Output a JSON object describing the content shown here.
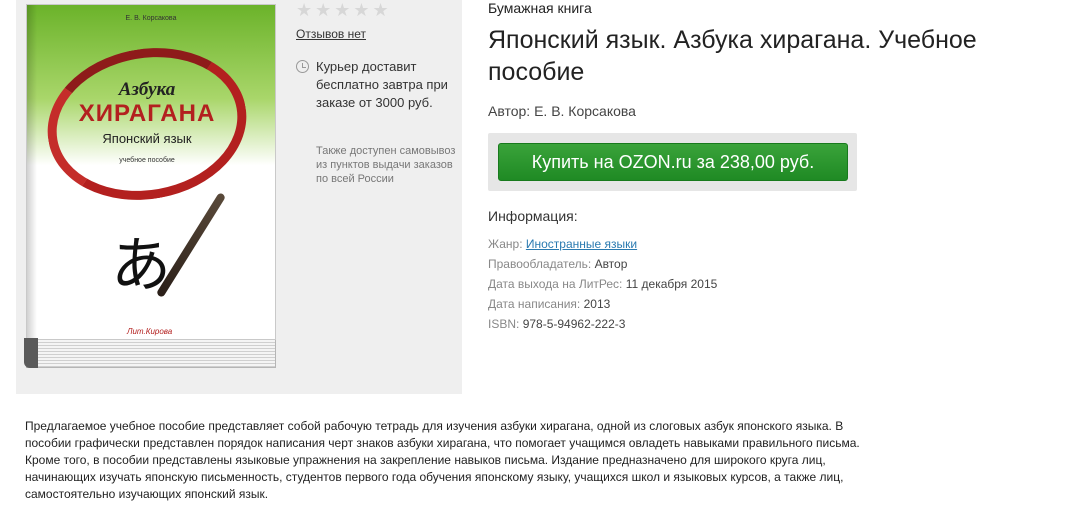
{
  "book_cover": {
    "author": "Е. В. Корсакова",
    "line1": "Азбука",
    "line2": "ХИРАГАНА",
    "line3": "Японский язык",
    "line4": "учебное пособие",
    "glyph": "あ",
    "publisher": "Лит.Кирова"
  },
  "rating": {
    "stars": "★★★★★",
    "stars_filled": 0,
    "reviews_label": "Отзывов нет"
  },
  "delivery": {
    "courier_text": "Курьер доставит бесплатно завтра при заказе от 3000 руб.",
    "pickup_text": "Также доступен самовывоз из пунктов выдачи заказов по всей России"
  },
  "product": {
    "format": "Бумажная книга",
    "title": "Японский язык. Азбука хирагана. Учебное пособие",
    "author": "Автор: Е. В. Корсакова",
    "buy_label": "Купить на OZON.ru за 238,00 руб."
  },
  "info": {
    "heading": "Информация:",
    "rows": [
      {
        "key": "Жанр:",
        "value": "Иностранные языки"
      },
      {
        "key": "Правообладатель:",
        "value": "Автор"
      },
      {
        "key": "Дата выхода на ЛитРес:",
        "value": "11 декабря 2015"
      },
      {
        "key": "Дата написания:",
        "value": "2013"
      },
      {
        "key": "ISBN:",
        "value": "978-5-94962-222-3"
      }
    ]
  },
  "description": "Предлагаемое учебное пособие представляет собой рабочую тетрадь для изучения азбуки хирагана, одной из слоговых азбук японского языка. В пособии графически представлен порядок написания черт знаков азбуки хирагана, что помогает учащимся овладеть навыками правильного письма. Кроме того, в пособии представлены языковые упражнения на закрепление навыков письма. Издание предназначено для широкого круга лиц, начинающих изучать японскую письменность, студентов первого года обучения японскому языку, учащихся школ и языковых курсов, а также лиц, самостоятельно изучающих японский язык.",
  "colors": {
    "buy_button": "#1f8a24",
    "cover_accent": "#b3201f",
    "link": "#2a7ab0"
  }
}
